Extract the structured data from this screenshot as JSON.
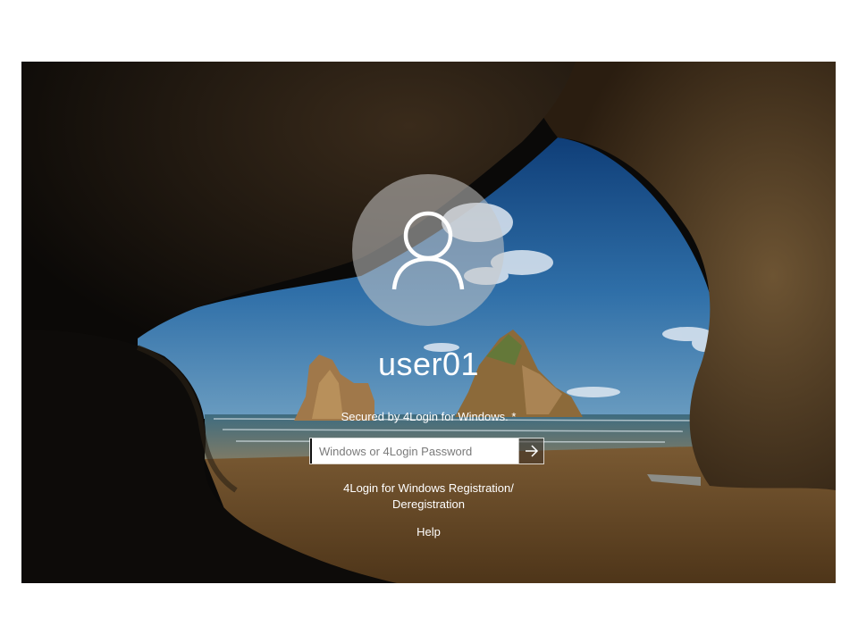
{
  "login": {
    "username": "user01",
    "secured_text": "Secured by 4Login for Windows. *",
    "password": {
      "value": "",
      "placeholder": "Windows or 4Login Password"
    },
    "submit_icon": "arrow-right-icon",
    "avatar_icon": "user-icon",
    "registration_link": {
      "line1": "4Login for Windows Registration/",
      "line2": "Deregistration"
    },
    "help_link": "Help"
  },
  "colors": {
    "sky": "#1f5f9c",
    "sea": "#3d6f8a",
    "sand": "#6b4a26",
    "cave": "#0a0a0a",
    "text": "#ffffff"
  }
}
